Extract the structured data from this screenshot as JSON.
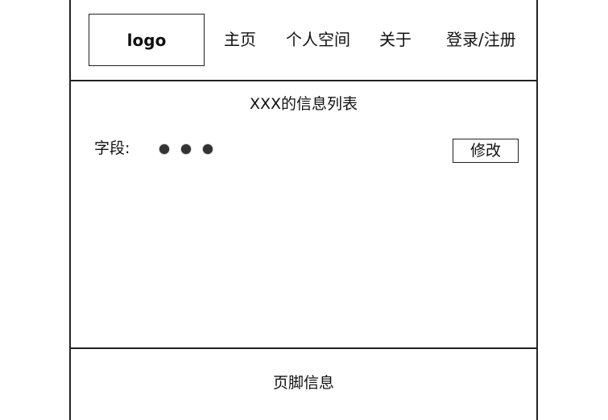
{
  "header": {
    "logo": "logo",
    "nav": {
      "home": "主页",
      "personal_space": "个人空间",
      "about": "关于",
      "login_register": "登录/注册"
    }
  },
  "main": {
    "list_title": "XXX的信息列表",
    "field_label": "字段:",
    "edit_button": "修改"
  },
  "footer": {
    "text": "页脚信息"
  }
}
